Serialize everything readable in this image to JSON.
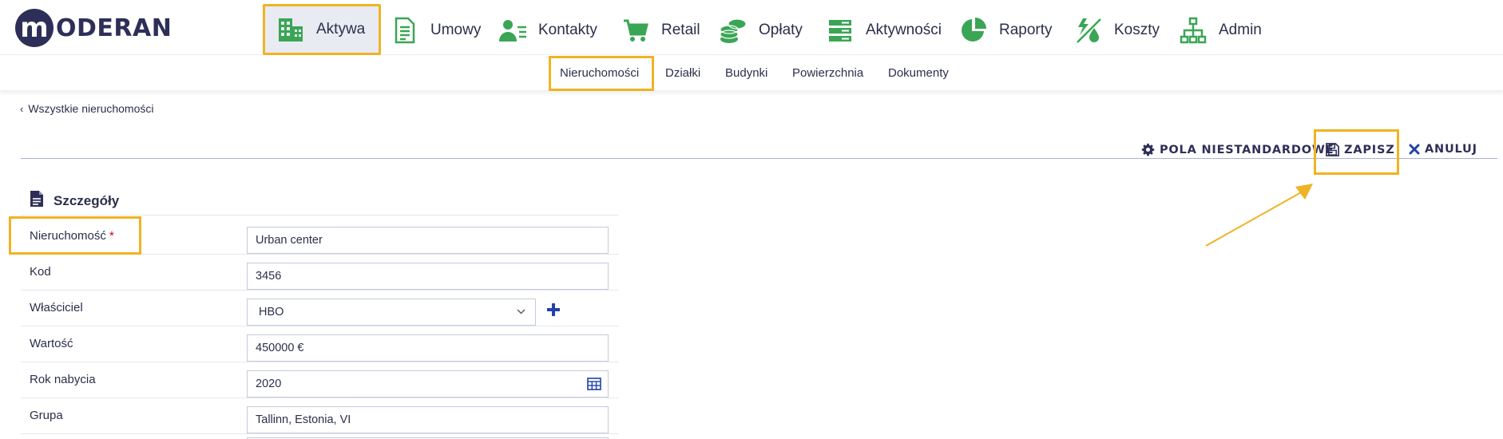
{
  "app": {
    "logo_letter": "m",
    "logo_text": "ODERAN"
  },
  "nav": {
    "items": [
      {
        "label": "Aktywa",
        "icon": "buildings-icon"
      },
      {
        "label": "Umowy",
        "icon": "document-icon"
      },
      {
        "label": "Kontakty",
        "icon": "contacts-icon"
      },
      {
        "label": "Retail",
        "icon": "cart-icon"
      },
      {
        "label": "Opłaty",
        "icon": "coins-icon"
      },
      {
        "label": "Aktywności",
        "icon": "list-icon"
      },
      {
        "label": "Raporty",
        "icon": "pie-chart-icon"
      },
      {
        "label": "Koszty",
        "icon": "utilities-icon"
      },
      {
        "label": "Admin",
        "icon": "org-chart-icon"
      }
    ],
    "active": "Aktywa"
  },
  "subnav": {
    "items": [
      "Nieruchomości",
      "Działki",
      "Budynki",
      "Powierzchnia",
      "Dokumenty"
    ],
    "active": "Nieruchomości"
  },
  "breadcrumb": {
    "back_label": "Wszystkie nieruchomości"
  },
  "actions": {
    "custom_fields": "POLA NIESTANDARDOWE",
    "save": "ZAPISZ",
    "cancel": "ANULUJ"
  },
  "section": {
    "title": "Szczegóły",
    "fields": [
      {
        "label": "Nieruchomość",
        "required": "*",
        "value": "Urban center"
      },
      {
        "label": "Kod",
        "value": "3456"
      },
      {
        "label": "Właściciel",
        "value": "HBO"
      },
      {
        "label": "Wartość",
        "value": "450000 €"
      },
      {
        "label": "Rok nabycia",
        "value": "2020"
      },
      {
        "label": "Grupa",
        "value": "Tallinn, Estonia, VI"
      }
    ]
  },
  "colors": {
    "accent": "#f0b323",
    "nav_green": "#3aa655",
    "brand": "#2e2f58",
    "plus_blue": "#2143a8"
  }
}
